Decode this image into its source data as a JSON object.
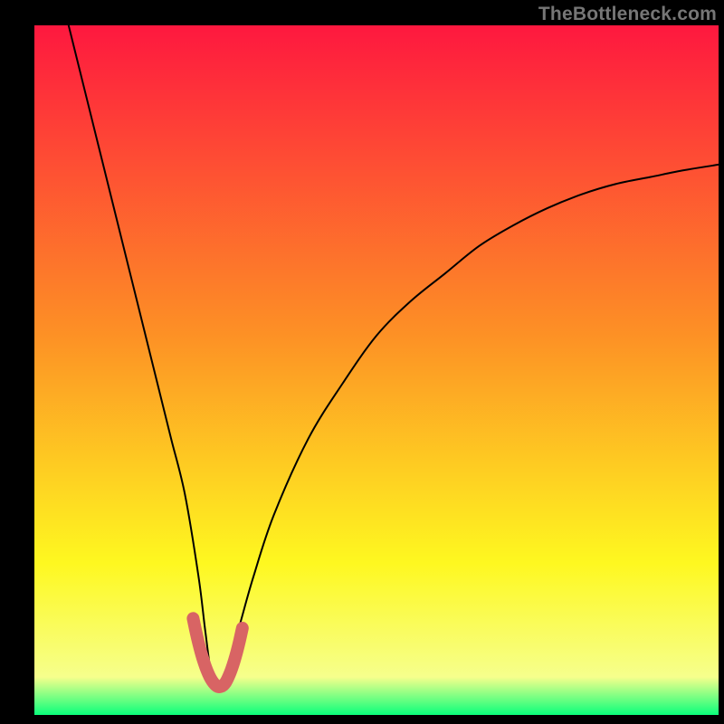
{
  "watermark": "TheBottleneck.com",
  "colors": {
    "gradient_top": "#fe183f",
    "gradient_mid1": "#fd9125",
    "gradient_mid2": "#fef820",
    "gradient_low": "#f6ff8c",
    "gradient_base": "#0aff7b",
    "curve": "#000000",
    "marker": "#d86464",
    "frame": "#000000"
  },
  "chart_data": {
    "type": "line",
    "title": "",
    "xlabel": "",
    "ylabel": "",
    "xlim": [
      0,
      100
    ],
    "ylim": [
      0,
      100
    ],
    "series": [
      {
        "name": "bottleneck-curve",
        "x": [
          5,
          8,
          10,
          12,
          14,
          16,
          18,
          20,
          22,
          24,
          25,
          26,
          27,
          28,
          30,
          32,
          35,
          40,
          45,
          50,
          55,
          60,
          65,
          70,
          75,
          80,
          85,
          90,
          95,
          100
        ],
        "values": [
          100,
          88,
          80,
          72,
          64,
          56,
          48,
          40,
          32,
          20,
          12,
          5,
          4,
          6,
          13,
          20,
          29,
          40,
          48,
          55,
          60,
          64,
          68,
          71,
          73.5,
          75.5,
          77,
          78,
          79,
          79.8
        ]
      },
      {
        "name": "optimal-marker",
        "x": [
          23.2,
          23.6,
          24.0,
          24.4,
          24.8,
          25.2,
          25.6,
          26.0,
          26.4,
          26.8,
          27.2,
          27.6,
          28.0,
          28.4,
          28.8,
          29.2,
          29.6,
          30.0,
          30.4
        ],
        "values": [
          14.0,
          12.1,
          10.4,
          8.9,
          7.6,
          6.5,
          5.6,
          4.9,
          4.4,
          4.1,
          4.1,
          4.3,
          4.8,
          5.6,
          6.6,
          7.8,
          9.2,
          10.8,
          12.6
        ]
      }
    ]
  }
}
